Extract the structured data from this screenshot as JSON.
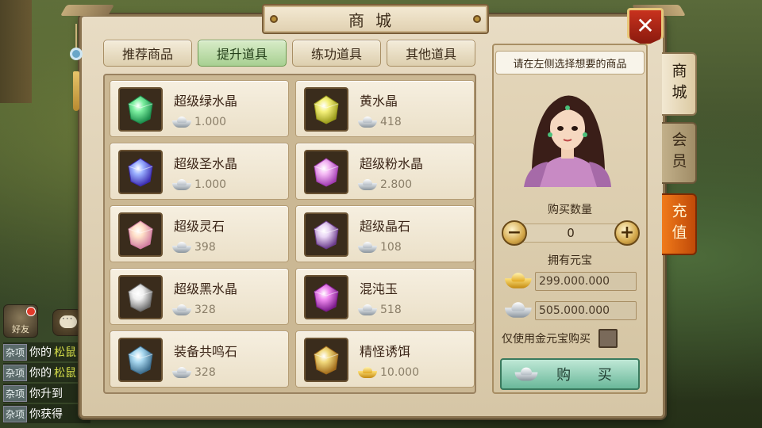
{
  "shop": {
    "title": "商城",
    "close_icon": "✕",
    "category_tabs": [
      "推荐商品",
      "提升道具",
      "练功道具",
      "其他道具"
    ],
    "active_tab_index": 1,
    "items": [
      {
        "name": "超级绿水晶",
        "price": "1.000",
        "currency": "silver",
        "icon": "green-crystal-icon"
      },
      {
        "name": "黄水晶",
        "price": "418",
        "currency": "silver",
        "icon": "yellow-crystal-icon"
      },
      {
        "name": "超级圣水晶",
        "price": "1.000",
        "currency": "silver",
        "icon": "blue-diamond-icon"
      },
      {
        "name": "超级粉水晶",
        "price": "2.800",
        "currency": "silver",
        "icon": "pink-crystal-icon"
      },
      {
        "name": "超级灵石",
        "price": "398",
        "currency": "silver",
        "icon": "spirit-stone-icon"
      },
      {
        "name": "超级晶石",
        "price": "108",
        "currency": "silver",
        "icon": "purple-ore-icon"
      },
      {
        "name": "超级黑水晶",
        "price": "328",
        "currency": "silver",
        "icon": "black-crystal-icon"
      },
      {
        "name": "混沌玉",
        "price": "518",
        "currency": "silver",
        "icon": "chaos-jade-icon"
      },
      {
        "name": "装备共鸣石",
        "price": "328",
        "currency": "silver",
        "icon": "resonance-stone-icon"
      },
      {
        "name": "精怪诱饵",
        "price": "10.000",
        "currency": "gold",
        "icon": "bait-bag-icon"
      }
    ]
  },
  "purchase": {
    "hint": "请在左侧选择想要的商品",
    "quantity_label": "购买数量",
    "quantity": "0",
    "minus": "−",
    "plus": "+",
    "currency_label": "拥有元宝",
    "gold_balance": "299.000.000",
    "silver_balance": "505.000.000",
    "gold_only_label": "仅使用金元宝购买",
    "buy_label": "购 买"
  },
  "side_tabs": [
    "商城",
    "会员",
    "充值"
  ],
  "chat": {
    "friend_label": "好友",
    "lines": [
      {
        "tag": "杂项",
        "text": "你的",
        "highlight": "松鼠"
      },
      {
        "tag": "杂项",
        "text": "你的",
        "highlight": "松鼠"
      },
      {
        "tag": "杂项",
        "text": "你升到",
        "highlight": ""
      },
      {
        "tag": "杂项",
        "text": "你获得",
        "highlight": ""
      }
    ]
  },
  "colors": {
    "active_tab": "#a8d092",
    "buy_button": "#6ab89a",
    "recharge_tab": "#e06a14",
    "close_button": "#b42a18"
  }
}
